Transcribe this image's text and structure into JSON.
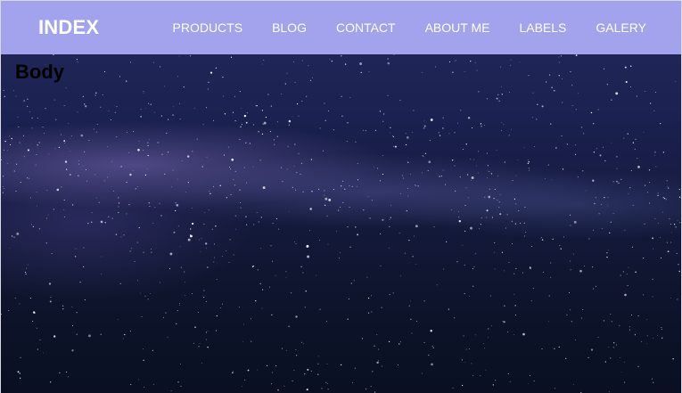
{
  "header": {
    "brand": "INDEX",
    "nav": [
      {
        "label": "PRODUCTS"
      },
      {
        "label": "BLOG"
      },
      {
        "label": "CONTACT"
      },
      {
        "label": "ABOUT ME"
      },
      {
        "label": "LABELS"
      },
      {
        "label": "GALERY"
      }
    ],
    "background_color": "#a3a2ec"
  },
  "main": {
    "heading": "Body",
    "background": "milky-way-night-sky-image"
  }
}
